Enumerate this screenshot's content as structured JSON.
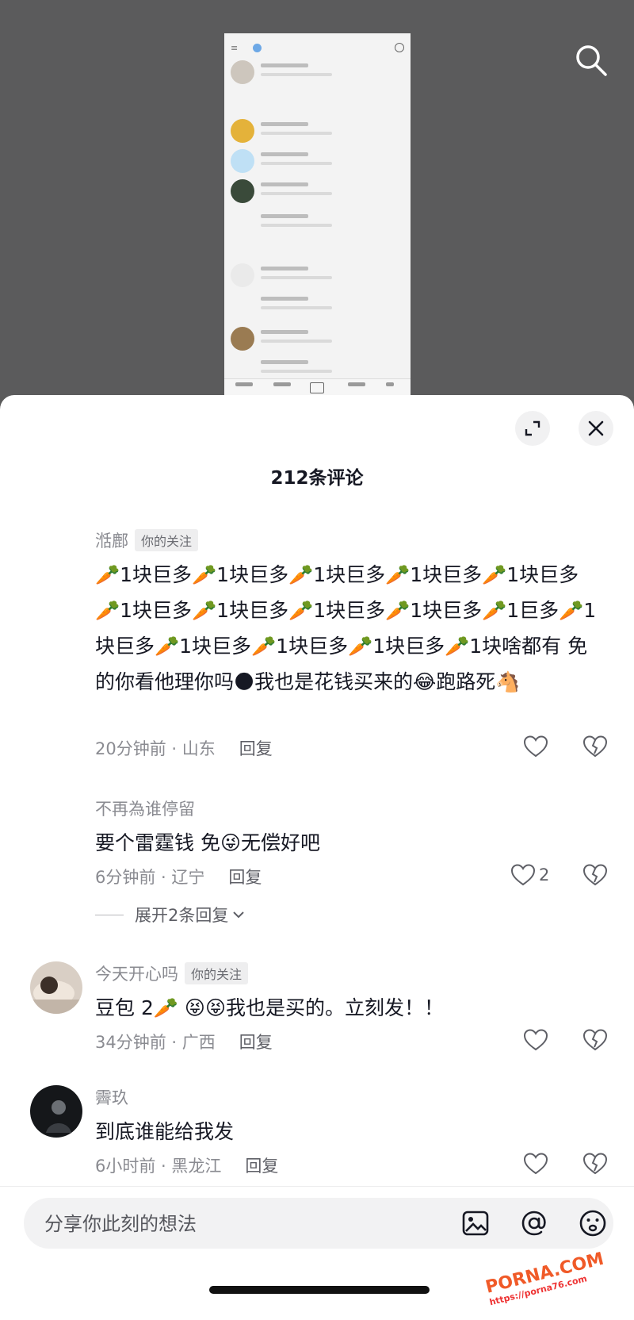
{
  "sheet": {
    "title": "212条评论"
  },
  "comments": [
    {
      "username": "湉鄜",
      "tag": "你的关注",
      "text": "🥕1块巨多🥕1块巨多🥕1块巨多🥕1块巨多🥕1块巨多🥕1块巨多🥕1块巨多🥕1块巨多🥕1块巨多🥕1巨多🥕1块巨多🥕1块巨多🥕1块巨多🥕1块巨多🥕1块啥都有 免的你看他理你吗🌑我也是花钱买来的😂跑路死🐴",
      "time": "20分钟前 · 山东",
      "reply": "回复"
    },
    {
      "username": "不再為谁停留",
      "text": "要个雷霆钱 免😜无偿好吧",
      "time": "6分钟前 · 辽宁",
      "reply": "回复",
      "likes": "2",
      "expand": "展开2条回复"
    },
    {
      "username": "今天开心吗",
      "tag": "你的关注",
      "text": "豆包 2🥕 😝😝我也是买的。立刻发！！",
      "time": "34分钟前 · 广西",
      "reply": "回复"
    },
    {
      "username": "霽玖",
      "text": "到底谁能给我发",
      "time": "6小时前 · 黑龙江",
      "reply": "回复"
    }
  ],
  "input": {
    "placeholder": "分享你此刻的想法"
  },
  "watermark": {
    "main": "PORNA.COM",
    "sub": "https://porna76.com"
  },
  "icons": {
    "search": "search-icon",
    "expand": "expand-icon",
    "close": "close-icon",
    "like": "heart-icon",
    "dislike": "broken-heart-icon",
    "image": "image-icon",
    "mention": "at-icon",
    "emoji": "emoji-icon"
  }
}
